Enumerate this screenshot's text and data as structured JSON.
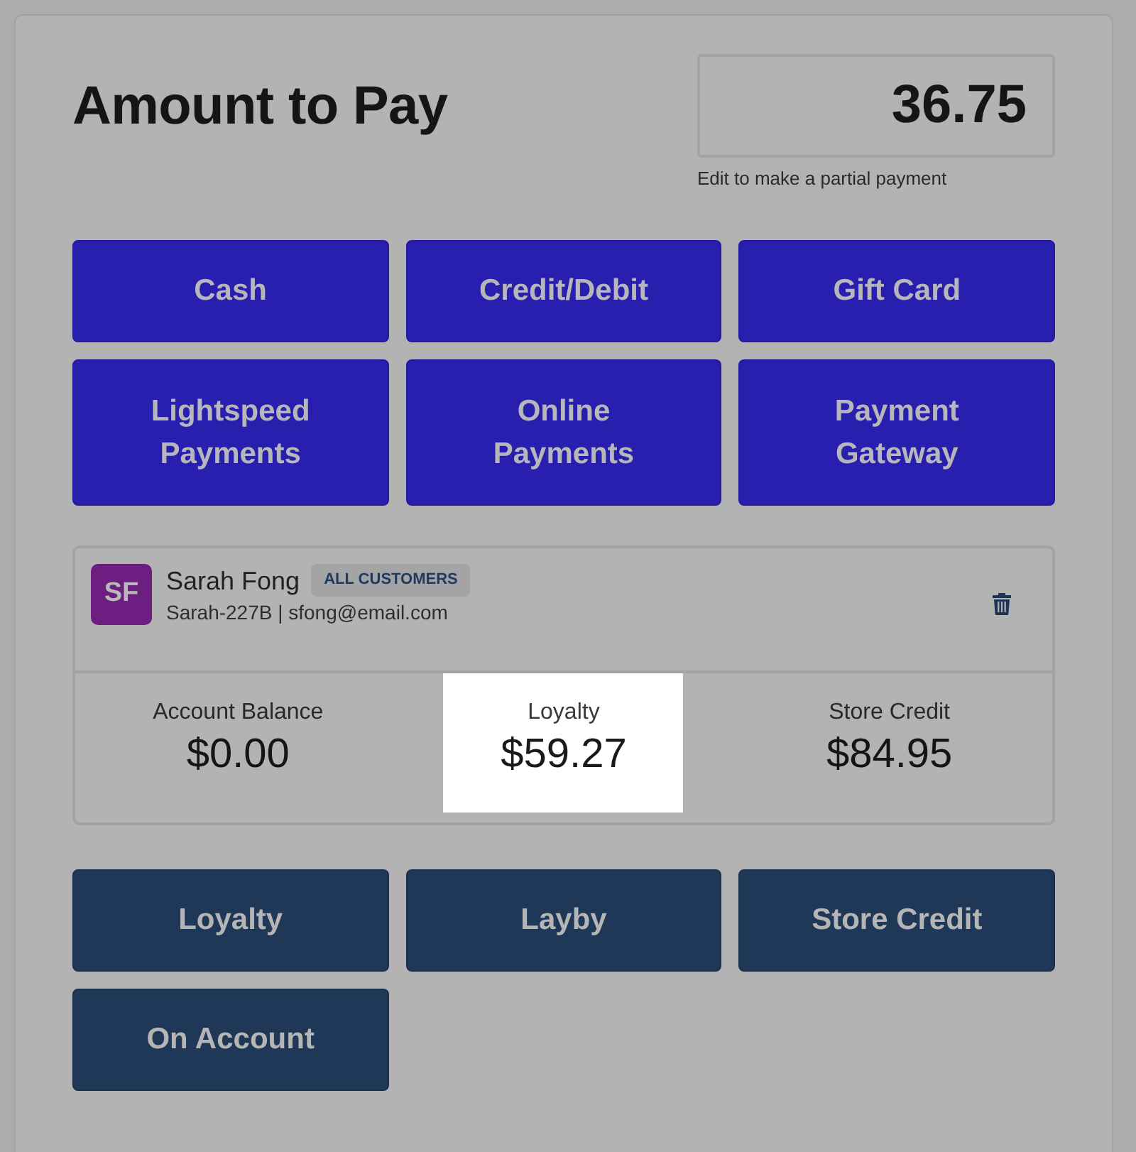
{
  "amount": {
    "title": "Amount to Pay",
    "value": "36.75",
    "hint": "Edit to make a partial payment"
  },
  "payment_methods": [
    {
      "label": "Cash"
    },
    {
      "label": "Credit/Debit"
    },
    {
      "label": "Gift Card"
    },
    {
      "label": "Lightspeed Payments"
    },
    {
      "label": "Online Payments"
    },
    {
      "label": "Payment Gateway"
    }
  ],
  "customer": {
    "initials": "SF",
    "name": "Sarah Fong",
    "group_badge": "ALL CUSTOMERS",
    "details": "Sarah-227B | sfong@email.com",
    "stats": [
      {
        "label": "Account Balance",
        "value": "$0.00",
        "highlighted": false
      },
      {
        "label": "Loyalty",
        "value": "$59.27",
        "highlighted": true
      },
      {
        "label": "Store Credit",
        "value": "$84.95",
        "highlighted": false
      }
    ]
  },
  "account_methods": [
    {
      "label": "Loyalty"
    },
    {
      "label": "Layby"
    },
    {
      "label": "Store Credit"
    },
    {
      "label": "On Account"
    }
  ]
}
